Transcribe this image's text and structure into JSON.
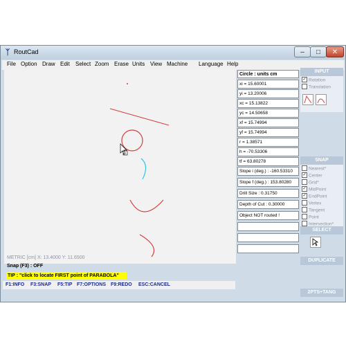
{
  "window": {
    "title": "RoutCad"
  },
  "colors": {
    "shape": "#d04040",
    "arc_cyan": "#30c8e0",
    "tip_bg": "#ffff00",
    "accent_text": "#1a2a8a"
  },
  "menubar": {
    "items": [
      "File",
      "Option",
      "Draw",
      "Edit",
      "Select",
      "Zoom",
      "Erase",
      "Units",
      "View",
      "Machine",
      "Language",
      "Help"
    ]
  },
  "canvas": {
    "coord_readout": "METRIC [cm]  X: 13.4000  Y: 11.6500"
  },
  "status": {
    "snap": "Snap (F3) : OFF",
    "tip": "TIP : \"click to locate FIRST point of PARABOLA\"",
    "fkeys": [
      "F1:INFO",
      "F3:SNAP",
      "F5:TIP",
      "F7:OPTIONS",
      "F9:REDO",
      "ESC:CANCEL"
    ]
  },
  "properties": {
    "title": "Circle : units cm",
    "fields": [
      "xi = 15.60001",
      "yi = 13.20006",
      "xc = 15.13822",
      "yc = 14.50658",
      "xf = 15.74994",
      "yf = 15.74994",
      "r = 1.38571",
      "h = -70.53306",
      "tf = 63.80278",
      "Slope i (deg.) : -160.53310",
      "Slope f (deg.) : 153.80280",
      "Drill Size     : 0.31750",
      "Depth of Cut : 0.30000",
      "Object NOT routed !",
      "",
      "",
      ""
    ]
  },
  "tools": {
    "input": {
      "label": "INPUT",
      "options": [
        {
          "label": "Rotation",
          "checked": true
        },
        {
          "label": "Translation",
          "checked": false
        }
      ]
    },
    "snap": {
      "label": "SNAP",
      "options": [
        {
          "label": "Nearest*",
          "checked": false
        },
        {
          "label": "Center",
          "checked": true
        },
        {
          "label": "Grid*",
          "checked": false
        },
        {
          "label": "MidPoint",
          "checked": true
        },
        {
          "label": "EndPoint",
          "checked": true
        },
        {
          "label": "Vertex",
          "checked": false
        },
        {
          "label": "Tangent",
          "checked": false
        },
        {
          "label": "Point",
          "checked": false
        },
        {
          "label": "Intersection*",
          "checked": false
        }
      ]
    },
    "select": {
      "label": "SELECT"
    },
    "duplicate": {
      "label": "DUPLICATE"
    },
    "two_pts_tang": {
      "label": "2PTS+TANG"
    }
  }
}
